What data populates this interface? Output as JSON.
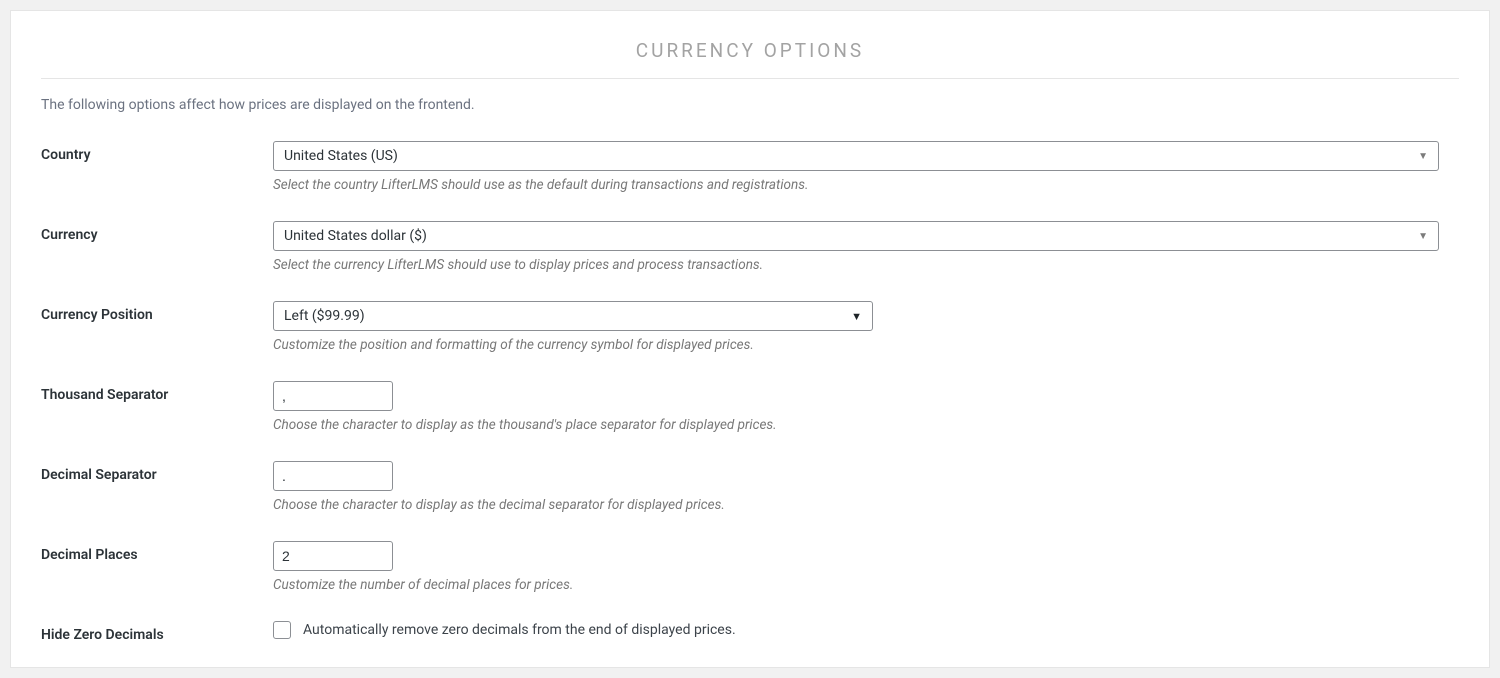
{
  "section": {
    "title": "CURRENCY OPTIONS",
    "description": "The following options affect how prices are displayed on the frontend."
  },
  "fields": {
    "country": {
      "label": "Country",
      "value": "United States (US)",
      "help": "Select the country LifterLMS should use as the default during transactions and registrations."
    },
    "currency": {
      "label": "Currency",
      "value": "United States dollar ($)",
      "help": "Select the currency LifterLMS should use to display prices and process transactions."
    },
    "currency_position": {
      "label": "Currency Position",
      "value": "Left ($99.99)",
      "help": "Customize the position and formatting of the currency symbol for displayed prices."
    },
    "thousand_separator": {
      "label": "Thousand Separator",
      "value": ",",
      "help": "Choose the character to display as the thousand's place separator for displayed prices."
    },
    "decimal_separator": {
      "label": "Decimal Separator",
      "value": ".",
      "help": "Choose the character to display as the decimal separator for displayed prices."
    },
    "decimal_places": {
      "label": "Decimal Places",
      "value": "2",
      "help": "Customize the number of decimal places for prices."
    },
    "hide_zero_decimals": {
      "label": "Hide Zero Decimals",
      "checkbox_label": "Automatically remove zero decimals from the end of displayed prices."
    }
  }
}
